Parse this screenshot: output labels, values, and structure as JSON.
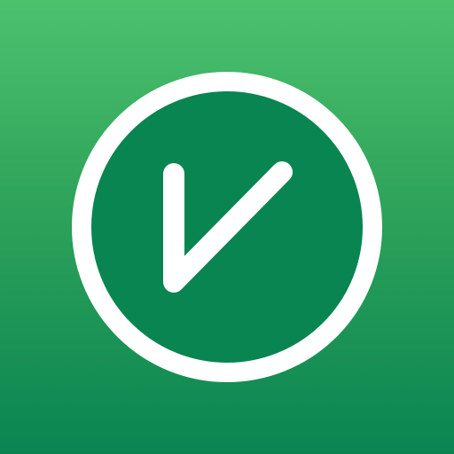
{
  "app_icon": {
    "icon_name": "check-circle-icon",
    "colors": {
      "background_top": "#4cc26f",
      "background_bottom": "#0a8552",
      "disc_fill": "#088551",
      "ring": "#ffffff",
      "mark": "#ffffff"
    }
  }
}
